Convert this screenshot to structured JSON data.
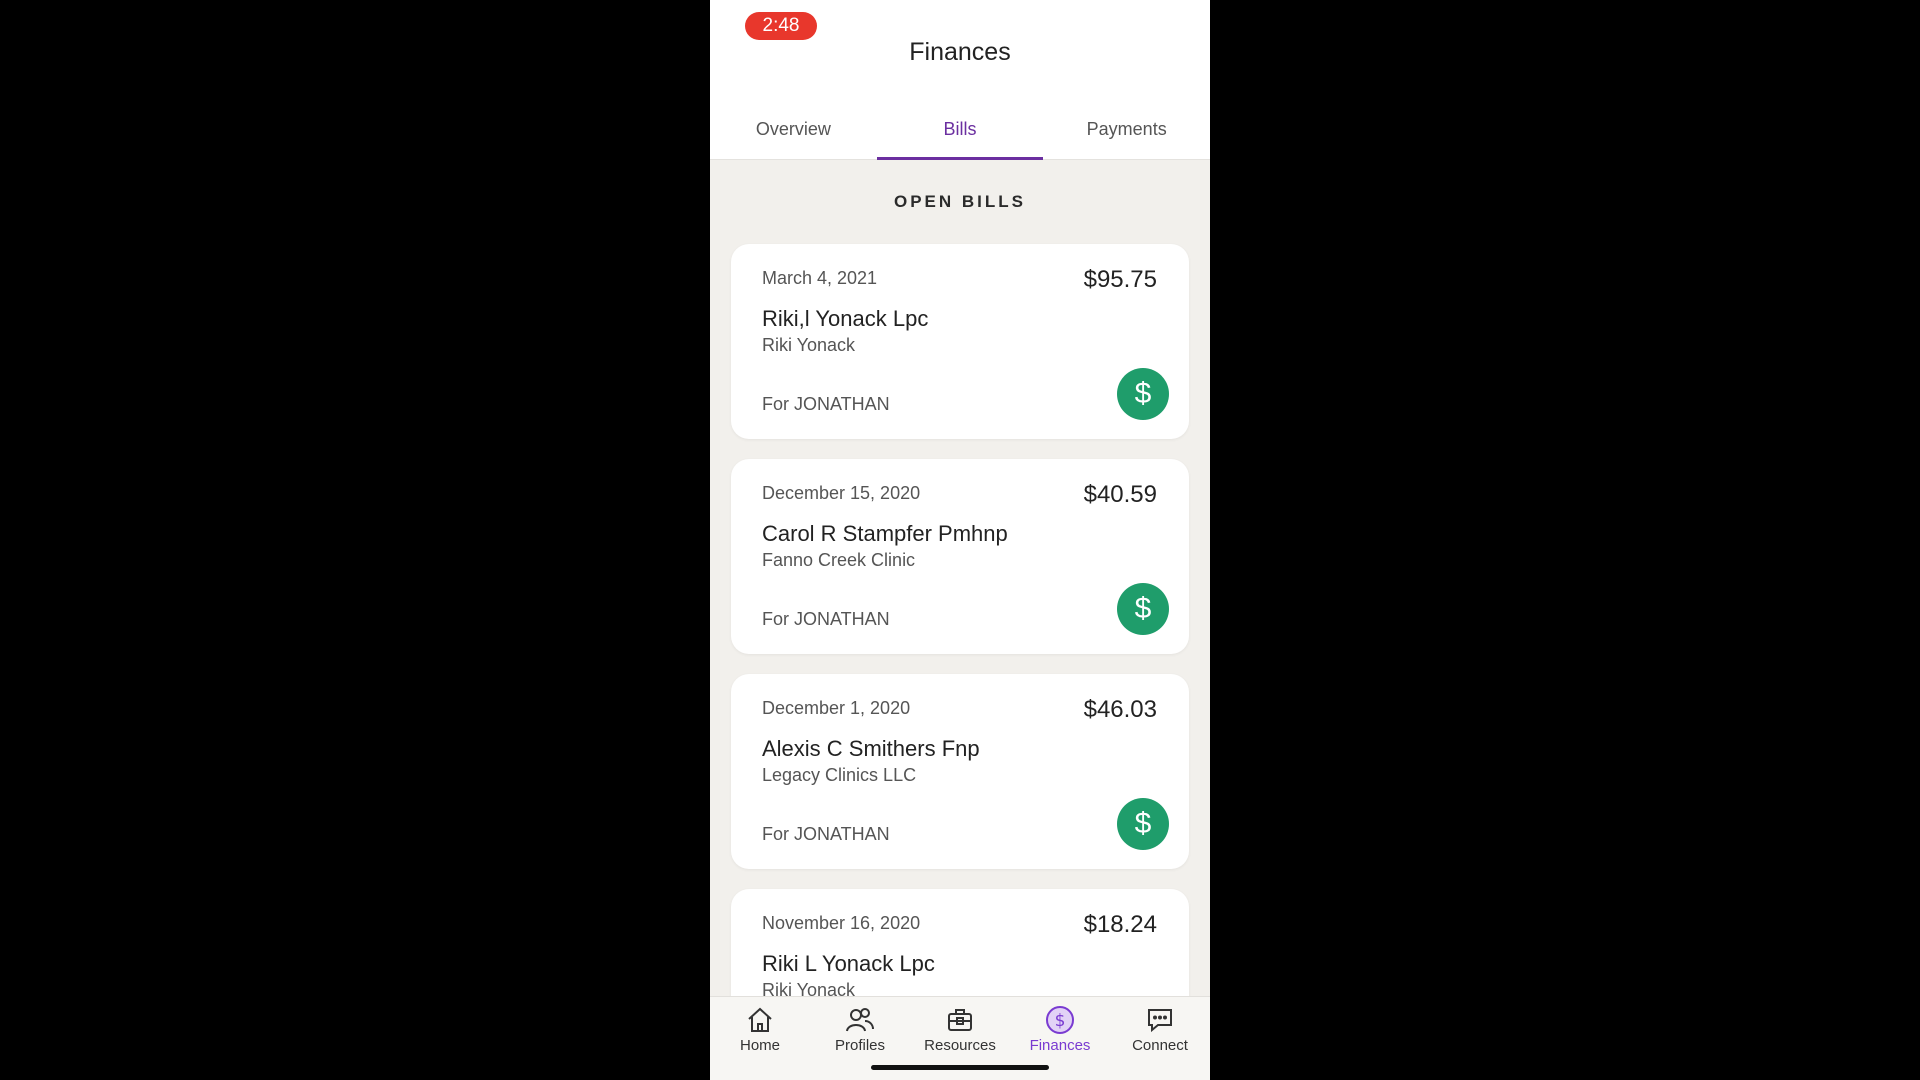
{
  "status": {
    "time": "2:48"
  },
  "screen": {
    "title": "Finances"
  },
  "tabs": [
    {
      "label": "Overview",
      "active": false
    },
    {
      "label": "Bills",
      "active": true
    },
    {
      "label": "Payments",
      "active": false
    }
  ],
  "section_title": "OPEN BILLS",
  "bills": [
    {
      "date": "March 4, 2021",
      "amount": "$95.75",
      "provider": "Riki,l Yonack Lpc",
      "org": "Riki Yonack",
      "patient": "For JONATHAN",
      "pay_icon": "$"
    },
    {
      "date": "December 15, 2020",
      "amount": "$40.59",
      "provider": "Carol R Stampfer Pmhnp",
      "org": "Fanno Creek Clinic",
      "patient": "For JONATHAN",
      "pay_icon": "$"
    },
    {
      "date": "December 1, 2020",
      "amount": "$46.03",
      "provider": "Alexis C Smithers Fnp",
      "org": "Legacy Clinics LLC",
      "patient": "For JONATHAN",
      "pay_icon": "$"
    },
    {
      "date": "November 16, 2020",
      "amount": "$18.24",
      "provider": "Riki L Yonack Lpc",
      "org": "Riki Yonack",
      "patient": "",
      "pay_icon": ""
    }
  ],
  "nav": [
    {
      "label": "Home",
      "icon": "home-icon"
    },
    {
      "label": "Profiles",
      "icon": "profiles-icon"
    },
    {
      "label": "Resources",
      "icon": "resources-icon"
    },
    {
      "label": "Finances",
      "icon": "finances-icon",
      "active": true
    },
    {
      "label": "Connect",
      "icon": "connect-icon"
    }
  ],
  "colors": {
    "accent": "#6b2fa0",
    "pay_button": "#1f9d6b",
    "time_pill": "#e8372c"
  }
}
